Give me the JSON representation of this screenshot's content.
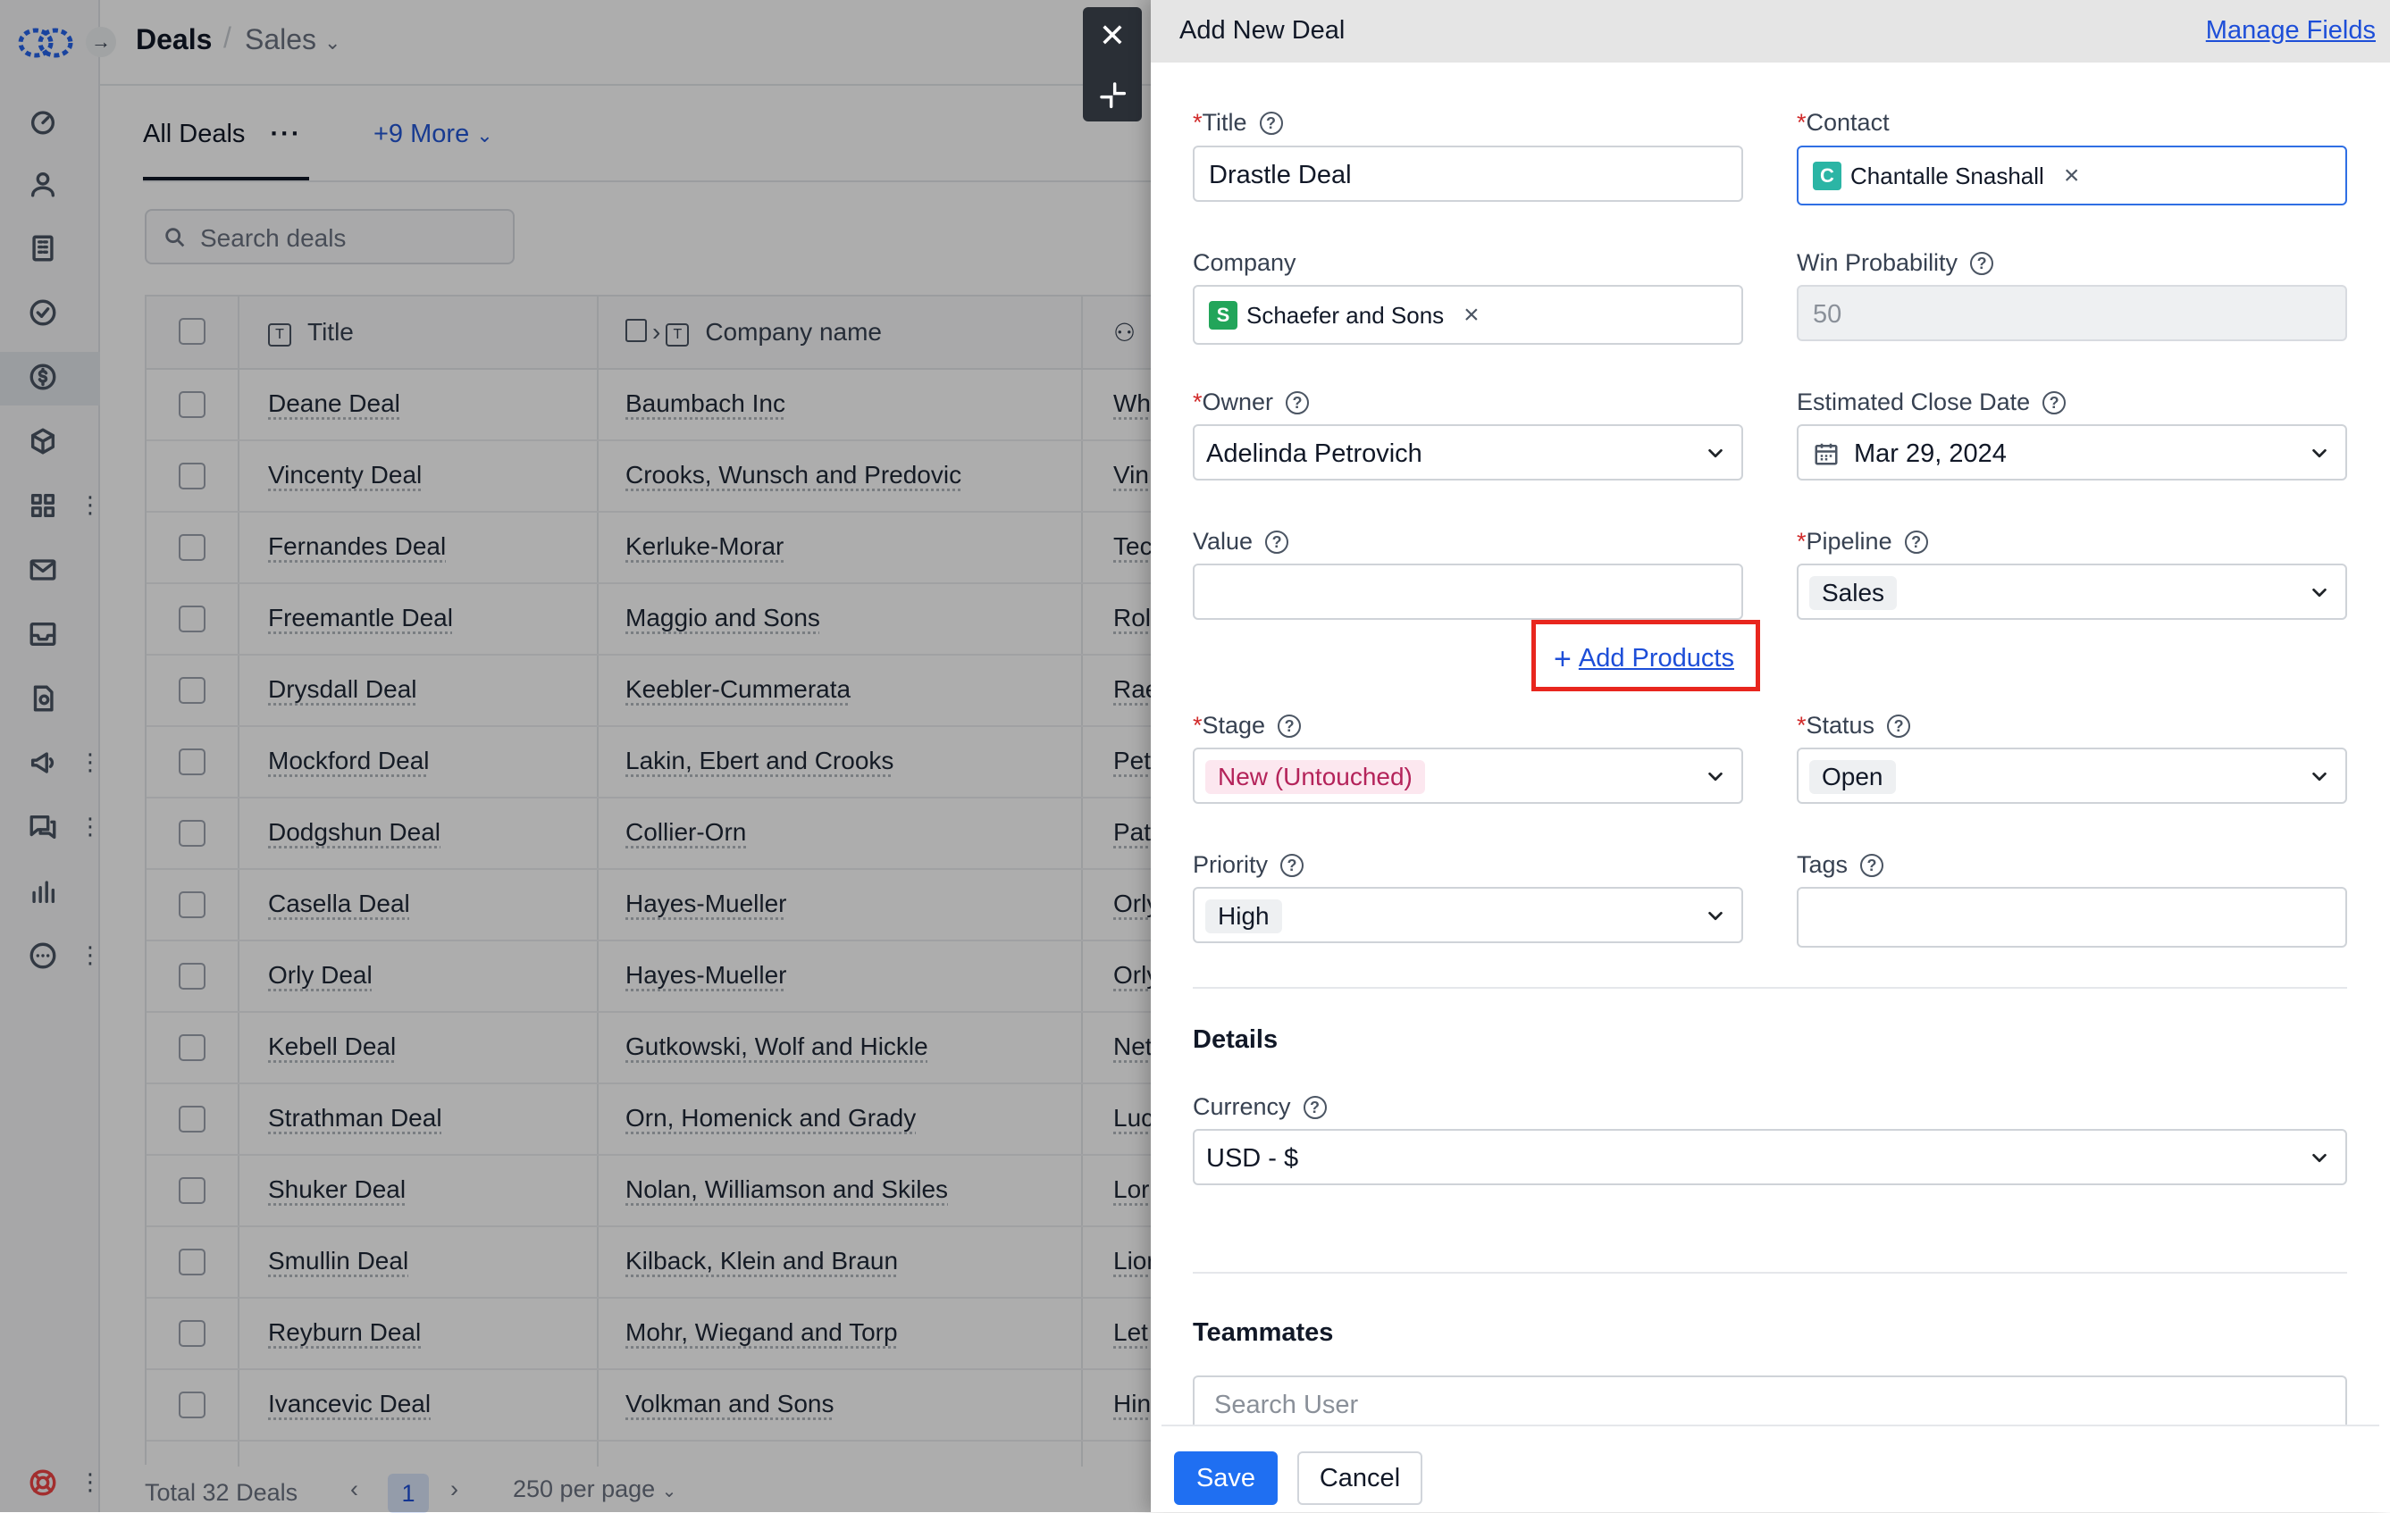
{
  "header": {
    "module": "Deals",
    "pipeline": "Sales"
  },
  "tabs": {
    "all": "All Deals",
    "more": "+9 More"
  },
  "search": {
    "placeholder": "Search deals"
  },
  "table": {
    "columns": [
      "Title",
      "Company name"
    ],
    "rows": [
      {
        "title": "Deane Deal",
        "company": "Baumbach Inc",
        "contact": "Wh"
      },
      {
        "title": "Vincenty Deal",
        "company": "Crooks, Wunsch and Predovic",
        "contact": "Vin"
      },
      {
        "title": "Fernandes Deal",
        "company": "Kerluke-Morar",
        "contact": "Tec"
      },
      {
        "title": "Freemantle Deal",
        "company": "Maggio and Sons",
        "contact": "Rol"
      },
      {
        "title": "Drysdall Deal",
        "company": "Keebler-Cummerata",
        "contact": "Rae"
      },
      {
        "title": "Mockford Deal",
        "company": "Lakin, Ebert and Crooks",
        "contact": "Pet"
      },
      {
        "title": "Dodgshun Deal",
        "company": "Collier-Orn",
        "contact": "Pat"
      },
      {
        "title": "Casella Deal",
        "company": "Hayes-Mueller",
        "contact": "Orly"
      },
      {
        "title": "Orly Deal",
        "company": "Hayes-Mueller",
        "contact": "Orly"
      },
      {
        "title": "Kebell Deal",
        "company": "Gutkowski, Wolf and Hickle",
        "contact": "Net"
      },
      {
        "title": "Strathman Deal",
        "company": "Orn, Homenick and Grady",
        "contact": "Luc"
      },
      {
        "title": "Shuker Deal",
        "company": "Nolan, Williamson and Skiles",
        "contact": "Lor"
      },
      {
        "title": "Smullin Deal",
        "company": "Kilback, Klein and Braun",
        "contact": "Lior"
      },
      {
        "title": "Reyburn Deal",
        "company": "Mohr, Wiegand and Torp",
        "contact": "Let"
      },
      {
        "title": "Ivancevic Deal",
        "company": "Volkman and Sons",
        "contact": "Hin"
      }
    ]
  },
  "footer": {
    "total": "Total 32 Deals",
    "page": "1",
    "per_page": "250 per page"
  },
  "drawer": {
    "title": "Add New Deal",
    "manage_fields": "Manage Fields",
    "fields": {
      "title": {
        "label": "Title",
        "value": "Drastle Deal"
      },
      "contact": {
        "label": "Contact",
        "chip": "Chantalle Snashall",
        "initial": "C"
      },
      "company": {
        "label": "Company",
        "chip": "Schaefer and Sons",
        "initial": "S"
      },
      "win_probability": {
        "label": "Win Probability",
        "placeholder": "50"
      },
      "owner": {
        "label": "Owner",
        "value": "Adelinda Petrovich"
      },
      "close_date": {
        "label": "Estimated Close Date",
        "value": "Mar 29, 2024"
      },
      "value": {
        "label": "Value",
        "value": ""
      },
      "pipeline": {
        "label": "Pipeline",
        "value": "Sales"
      },
      "add_products": "Add Products",
      "stage": {
        "label": "Stage",
        "value": "New (Untouched)"
      },
      "status": {
        "label": "Status",
        "value": "Open"
      },
      "priority": {
        "label": "Priority",
        "value": "High"
      },
      "tags": {
        "label": "Tags",
        "value": ""
      }
    },
    "details": {
      "heading": "Details",
      "currency_label": "Currency",
      "currency_value": "USD - $"
    },
    "teammates": {
      "heading": "Teammates",
      "placeholder": "Search User"
    },
    "buttons": {
      "save": "Save",
      "cancel": "Cancel"
    }
  },
  "colors": {
    "accent": "#1f6ff2",
    "link": "#1d4ed8",
    "highlight_box": "#e8261e",
    "required": "#d12a2a",
    "stage_chip_bg": "#fce7ef",
    "stage_chip_text": "#b4235a",
    "contact_avatar": "#2bb5a5",
    "company_avatar": "#22a55a"
  }
}
